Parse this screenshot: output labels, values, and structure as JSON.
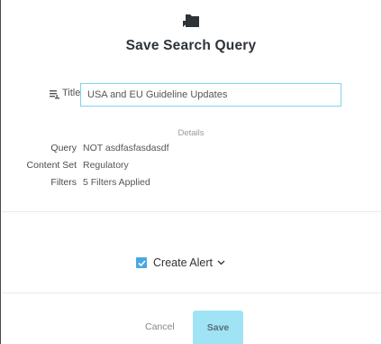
{
  "dialog": {
    "title": "Save Search Query",
    "header_icon": "folder-bookmark-icon"
  },
  "title_field": {
    "label": "Title",
    "label_icon": "list-icon",
    "value": "USA and EU Guideline Updates"
  },
  "details": {
    "heading": "Details",
    "rows": [
      {
        "key": "Query",
        "value": "NOT asdfasfasdasdf"
      },
      {
        "key": "Content Set",
        "value": "Regulatory"
      },
      {
        "key": "Filters",
        "value": "5 Filters Applied"
      }
    ]
  },
  "alert": {
    "label": "Create Alert",
    "checked": true,
    "accent": "#4aa7e0"
  },
  "footer": {
    "cancel_label": "Cancel",
    "save_label": "Save",
    "save_color": "#9fe3f5"
  }
}
